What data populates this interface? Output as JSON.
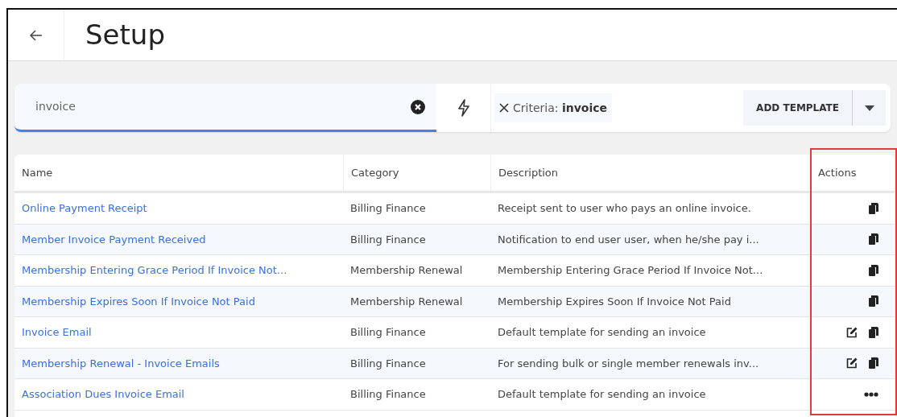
{
  "header": {
    "title": "Setup"
  },
  "search": {
    "value": "invoice"
  },
  "filter_chip": {
    "text": "Criteria: **invoice**"
  },
  "add_button": {
    "label": "ADD TEMPLATE"
  },
  "table": {
    "columns": [
      "Name",
      "Category",
      "Description",
      "Actions"
    ],
    "rows": [
      {
        "name": "Online Payment Receipt",
        "category": "Billing Finance",
        "description": "Receipt sent to user who pays an online invoice.",
        "actions": [
          {
            "kind": "copy"
          }
        ]
      },
      {
        "name": "Member Invoice Payment Received",
        "category": "Billing Finance",
        "description": "Notification to end user user, when he/she pay i...",
        "actions": [
          {
            "kind": "copy"
          }
        ]
      },
      {
        "name": "Membership Entering Grace Period If Invoice Not...",
        "category": "Membership Renewal",
        "description": "Membership Entering Grace Period If Invoice Not...",
        "actions": [
          {
            "kind": "copy"
          }
        ]
      },
      {
        "name": "Membership Expires Soon If Invoice Not Paid",
        "category": "Membership Renewal",
        "description": "Membership Expires Soon If Invoice Not Paid",
        "actions": [
          {
            "kind": "copy"
          }
        ]
      },
      {
        "name": "Invoice Email",
        "category": "Billing Finance",
        "description": "Default template for sending an invoice",
        "actions": [
          {
            "kind": "edit"
          },
          {
            "kind": "copy"
          }
        ]
      },
      {
        "name": "Membership Renewal - Invoice Emails",
        "category": "Billing Finance",
        "description": "For sending bulk or single member renewals inv...",
        "actions": [
          {
            "kind": "edit"
          },
          {
            "kind": "copy"
          }
        ]
      },
      {
        "name": "Association Dues Invoice Email",
        "category": "Billing Finance",
        "description": "Default template for sending an invoice",
        "actions": [
          {
            "kind": "more"
          }
        ]
      }
    ]
  }
}
